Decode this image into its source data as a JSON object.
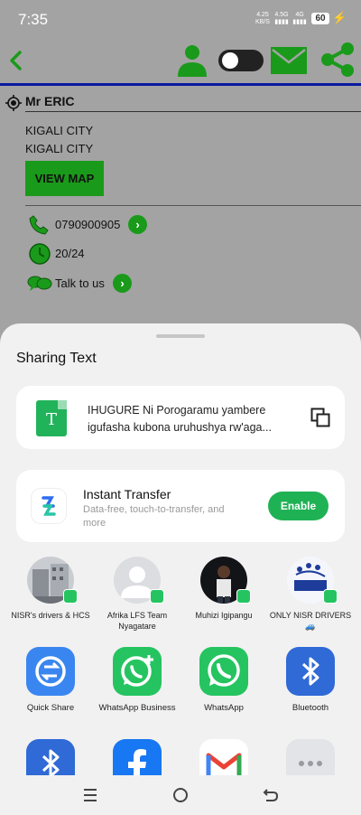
{
  "status_bar": {
    "time": "7:35",
    "net_speed": "4.25",
    "net_unit": "KB/S",
    "signal1": "4.5G",
    "signal2": "4G",
    "battery": "60"
  },
  "toolbar": {
    "icons": [
      "back-icon",
      "person-icon",
      "dark-mode-toggle",
      "mail-icon",
      "share-icon"
    ]
  },
  "contact": {
    "name": "Mr ERIC",
    "address_line1": "KIGALI CITY",
    "address_line2": "KIGALI CITY",
    "view_map_label": "VIEW MAP",
    "phone": "0790900905",
    "hours": "20/24",
    "talk_label": "Talk to us"
  },
  "share_sheet": {
    "title": "Sharing Text",
    "text_line1": "IHUGURE Ni Porogaramu yambere",
    "text_line2": "igufasha kubona uruhushya rw'aga...",
    "instant_transfer": {
      "title": "Instant Transfer",
      "subtitle": "Data-free, touch-to-transfer, and more",
      "button": "Enable"
    },
    "contacts": [
      {
        "label": "NISR's drivers & HCS"
      },
      {
        "label": "Afrika LFS Team Nyagatare"
      },
      {
        "label": "Muhizi Igipangu"
      },
      {
        "label": "ONLY NISR DRIVERS 🚙"
      }
    ],
    "apps": [
      {
        "label": "Quick Share"
      },
      {
        "label": "WhatsApp Business"
      },
      {
        "label": "WhatsApp"
      },
      {
        "label": "Bluetooth"
      }
    ]
  },
  "colors": {
    "accent_green": "#1a9a1a",
    "whatsapp_green": "#25c460",
    "enable_green": "#1fb255",
    "divider_blue": "#0a1aa0"
  }
}
